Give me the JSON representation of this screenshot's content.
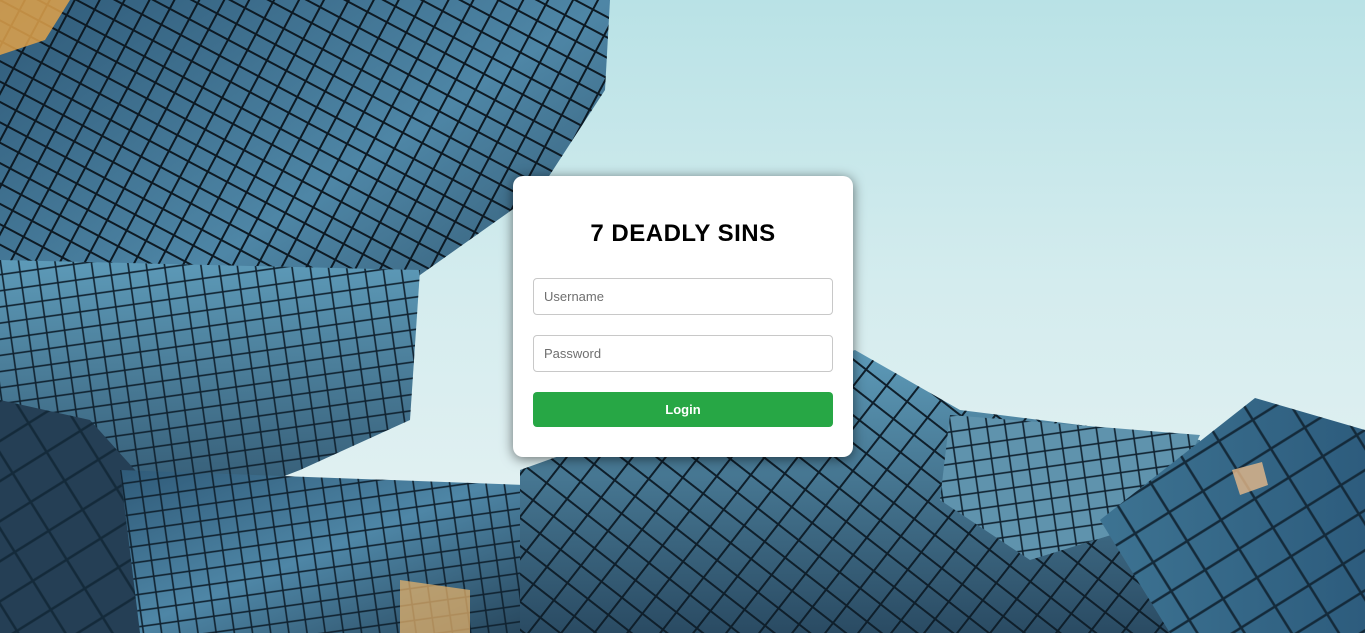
{
  "login": {
    "title": "7 DEADLY SINS",
    "username_placeholder": "Username",
    "username_value": "",
    "password_placeholder": "Password",
    "password_value": "",
    "button_label": "Login"
  },
  "colors": {
    "button": "#27a745",
    "card": "#ffffff",
    "sky": "#d4ecee",
    "glass": "#3f6f8f"
  }
}
